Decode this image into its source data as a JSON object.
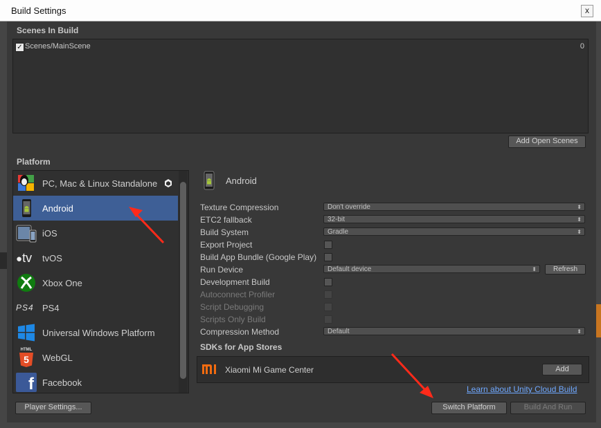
{
  "window": {
    "title": "Build Settings",
    "close_glyph": "x"
  },
  "scenes": {
    "header": "Scenes In Build",
    "items": [
      {
        "name": "Scenes/MainScene",
        "index": "0",
        "checked": true
      }
    ],
    "add_open_scenes": "Add Open Scenes"
  },
  "platform": {
    "header": "Platform",
    "items": [
      {
        "label": "PC, Mac & Linux Standalone",
        "icon": "pc-mac-linux-icon"
      },
      {
        "label": "Android",
        "icon": "android-icon",
        "selected": true
      },
      {
        "label": "iOS",
        "icon": "ios-icon"
      },
      {
        "label": "tvOS",
        "icon": "tvos-icon"
      },
      {
        "label": "Xbox One",
        "icon": "xbox-icon"
      },
      {
        "label": "PS4",
        "icon": "ps4-icon"
      },
      {
        "label": "Universal Windows Platform",
        "icon": "windows-icon"
      },
      {
        "label": "WebGL",
        "icon": "html5-icon"
      },
      {
        "label": "Facebook",
        "icon": "facebook-icon"
      }
    ],
    "icon_text": {
      "tvos": "tv",
      "ps4": "PS4",
      "html5": "5",
      "html5_top": "HTML",
      "facebook": "f"
    }
  },
  "selected_platform": {
    "title": "Android"
  },
  "settings": {
    "texture_compression": {
      "label": "Texture Compression",
      "value": "Don't override"
    },
    "etc2_fallback": {
      "label": "ETC2 fallback",
      "value": "32-bit"
    },
    "build_system": {
      "label": "Build System",
      "value": "Gradle"
    },
    "export_project": {
      "label": "Export Project"
    },
    "build_app_bundle": {
      "label": "Build App Bundle (Google Play)"
    },
    "run_device": {
      "label": "Run Device",
      "value": "Default device",
      "refresh": "Refresh"
    },
    "development_build": {
      "label": "Development Build"
    },
    "autoconnect_profiler": {
      "label": "Autoconnect Profiler"
    },
    "script_debugging": {
      "label": "Script Debugging"
    },
    "scripts_only_build": {
      "label": "Scripts Only Build"
    },
    "compression_method": {
      "label": "Compression Method",
      "value": "Default"
    }
  },
  "sdks": {
    "header": "SDKs for App Stores",
    "item": {
      "label": "Xiaomi Mi Game Center",
      "logo": "mi",
      "add": "Add"
    }
  },
  "cloud_link": "Learn about Unity Cloud Build",
  "buttons": {
    "player_settings": "Player Settings...",
    "switch_platform": "Switch Platform",
    "build_and_run": "Build And Run"
  },
  "colors": {
    "accent": "#3e5f96",
    "arrow": "#ff2a1a",
    "mi_orange": "#f26b10"
  }
}
